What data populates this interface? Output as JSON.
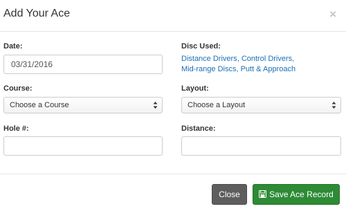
{
  "modal": {
    "title": "Add Your Ace",
    "close_glyph": "×"
  },
  "form": {
    "date": {
      "label": "Date:",
      "value": "03/31/2016"
    },
    "disc_used": {
      "label": "Disc Used:",
      "items": [
        "Distance Drivers",
        "Control Drivers",
        "Mid-range Discs",
        "Putt & Approach"
      ],
      "separator": ","
    },
    "course": {
      "label": "Course:",
      "selected": "Choose a Course"
    },
    "layout": {
      "label": "Layout:",
      "selected": "Choose a Layout"
    },
    "hole": {
      "label": "Hole #:",
      "value": ""
    },
    "distance": {
      "label": "Distance:",
      "value": ""
    }
  },
  "footer": {
    "close_label": "Close",
    "save_label": "Save Ace Record",
    "save_icon": "floppy-disk-icon"
  },
  "colors": {
    "link": "#1a6fb5",
    "close_button": "#5e5e5e",
    "save_button": "#2e8b35"
  }
}
